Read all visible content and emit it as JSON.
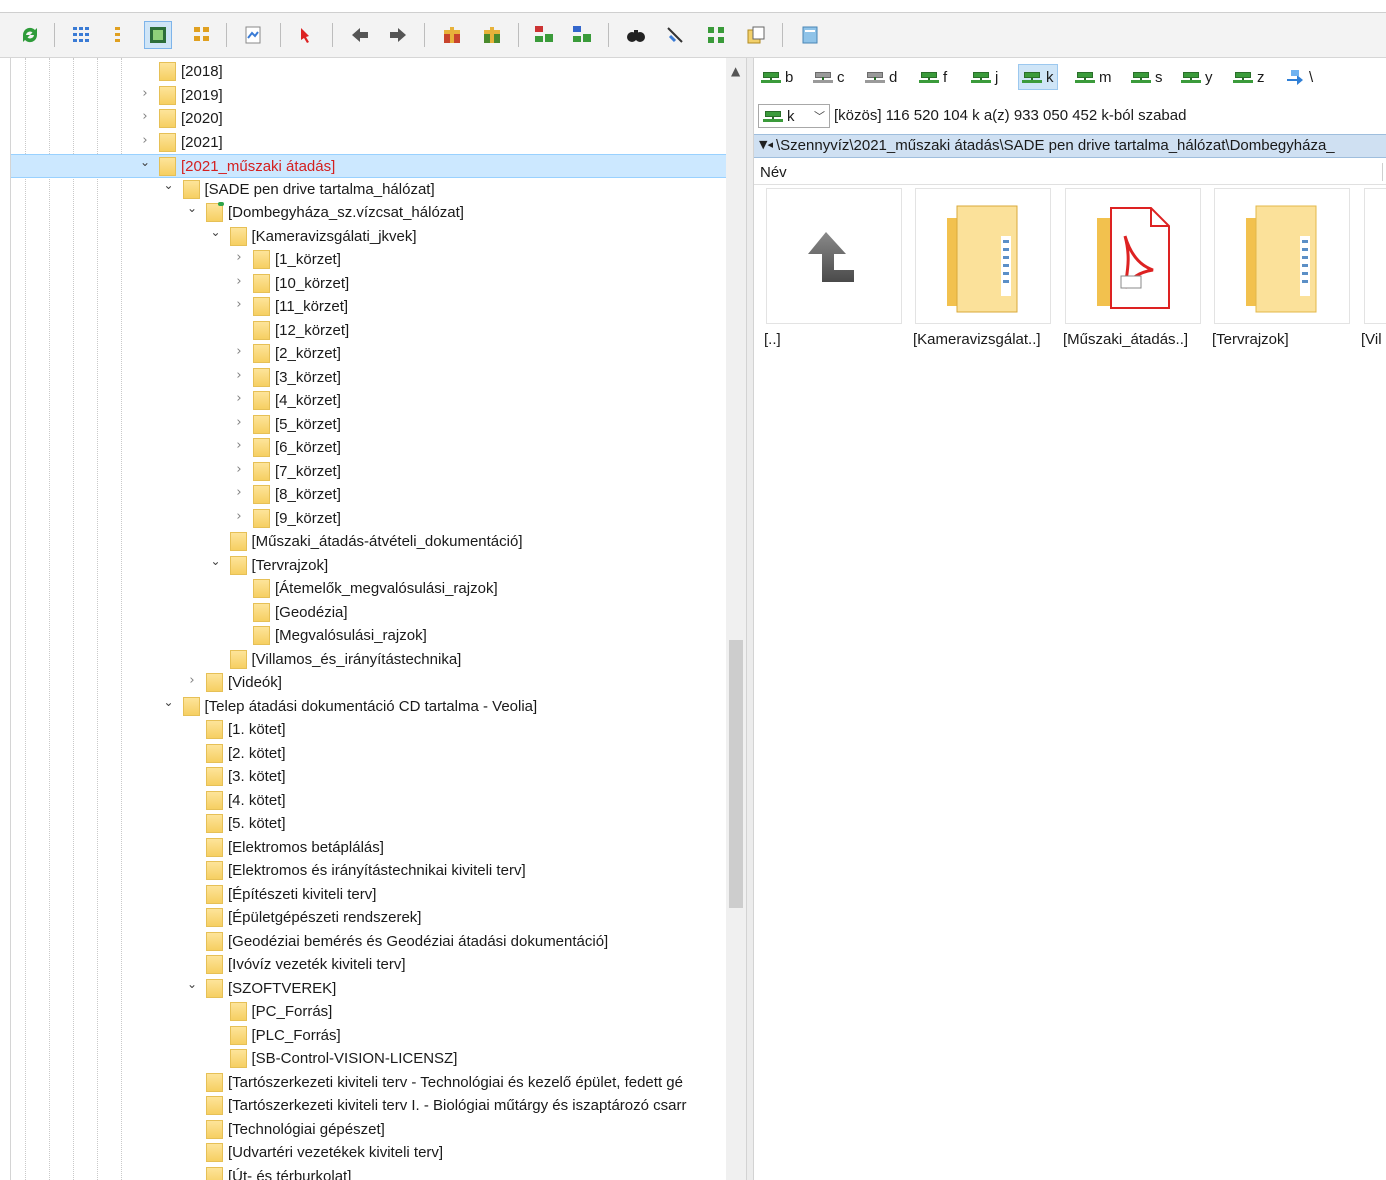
{
  "toolbar": {
    "buttons": [
      {
        "icon": "refresh-icon"
      },
      {
        "icon": "brief-view-icon"
      },
      {
        "icon": "detailed-view-icon"
      },
      {
        "icon": "thumbnail-view-icon"
      },
      {
        "icon": "tree-view-icon"
      },
      {
        "icon": "quick-view-icon"
      },
      {
        "icon": "select-icon"
      },
      {
        "icon": "back-icon"
      },
      {
        "icon": "forward-icon"
      },
      {
        "icon": "pack-icon"
      },
      {
        "icon": "unpack-icon"
      },
      {
        "icon": "ftp-connect-icon"
      },
      {
        "icon": "url-connect-icon"
      },
      {
        "icon": "search-icon"
      },
      {
        "icon": "multi-rename-icon"
      },
      {
        "icon": "sync-dirs-icon"
      },
      {
        "icon": "copy-names-icon"
      },
      {
        "icon": "notepad-icon"
      }
    ]
  },
  "tree": {
    "items": [
      {
        "label": "[2018]",
        "level": 0,
        "state": "none"
      },
      {
        "label": "[2019]",
        "level": 0,
        "state": "closed"
      },
      {
        "label": "[2020]",
        "level": 0,
        "state": "closed"
      },
      {
        "label": "[2021]",
        "level": 0,
        "state": "closed"
      },
      {
        "label": "[2021_műszaki átadás]",
        "level": 0,
        "state": "open",
        "selected": true
      },
      {
        "label": "[SADE pen drive tartalma_hálózat]",
        "level": 1,
        "state": "open"
      },
      {
        "label": "[Dombegyháza_sz.vízcsat_hálózat]",
        "level": 2,
        "state": "open",
        "green": true
      },
      {
        "label": "[Kameravizsgálati_jkvek]",
        "level": 3,
        "state": "open"
      },
      {
        "label": "[1_körzet]",
        "level": 4,
        "state": "closed"
      },
      {
        "label": "[10_körzet]",
        "level": 4,
        "state": "closed"
      },
      {
        "label": "[11_körzet]",
        "level": 4,
        "state": "closed"
      },
      {
        "label": "[12_körzet]",
        "level": 4,
        "state": "none"
      },
      {
        "label": "[2_körzet]",
        "level": 4,
        "state": "closed"
      },
      {
        "label": "[3_körzet]",
        "level": 4,
        "state": "closed"
      },
      {
        "label": "[4_körzet]",
        "level": 4,
        "state": "closed"
      },
      {
        "label": "[5_körzet]",
        "level": 4,
        "state": "closed"
      },
      {
        "label": "[6_körzet]",
        "level": 4,
        "state": "closed"
      },
      {
        "label": "[7_körzet]",
        "level": 4,
        "state": "closed"
      },
      {
        "label": "[8_körzet]",
        "level": 4,
        "state": "closed"
      },
      {
        "label": "[9_körzet]",
        "level": 4,
        "state": "closed"
      },
      {
        "label": "[Műszaki_átadás-átvételi_dokumentáció]",
        "level": 3,
        "state": "none"
      },
      {
        "label": "[Tervrajzok]",
        "level": 3,
        "state": "open"
      },
      {
        "label": "[Átemelők_megvalósulási_rajzok]",
        "level": 4,
        "state": "none"
      },
      {
        "label": "[Geodézia]",
        "level": 4,
        "state": "none"
      },
      {
        "label": "[Megvalósulási_rajzok]",
        "level": 4,
        "state": "none"
      },
      {
        "label": "[Villamos_és_irányítástechnika]",
        "level": 3,
        "state": "none"
      },
      {
        "label": "[Videók]",
        "level": 2,
        "state": "closed"
      },
      {
        "label": "[Telep átadási dokumentáció CD tartalma - Veolia]",
        "level": 1,
        "state": "open"
      },
      {
        "label": "[1. kötet]",
        "level": 2,
        "state": "none"
      },
      {
        "label": "[2. kötet]",
        "level": 2,
        "state": "none"
      },
      {
        "label": "[3. kötet]",
        "level": 2,
        "state": "none"
      },
      {
        "label": "[4. kötet]",
        "level": 2,
        "state": "none"
      },
      {
        "label": "[5. kötet]",
        "level": 2,
        "state": "none"
      },
      {
        "label": "[Elektromos betáplálás]",
        "level": 2,
        "state": "none"
      },
      {
        "label": "[Elektromos és irányítástechnikai kiviteli terv]",
        "level": 2,
        "state": "none"
      },
      {
        "label": "[Építészeti kiviteli terv]",
        "level": 2,
        "state": "none"
      },
      {
        "label": "[Épületgépészeti rendszerek]",
        "level": 2,
        "state": "none"
      },
      {
        "label": "[Geodéziai bemérés és Geodéziai átadási dokumentáció]",
        "level": 2,
        "state": "none"
      },
      {
        "label": "[Ivóvíz vezeték kiviteli terv]",
        "level": 2,
        "state": "none"
      },
      {
        "label": "[SZOFTVEREK]",
        "level": 2,
        "state": "open"
      },
      {
        "label": "[PC_Forrás]",
        "level": 3,
        "state": "none"
      },
      {
        "label": "[PLC_Forrás]",
        "level": 3,
        "state": "none"
      },
      {
        "label": "[SB-Control-VISION-LICENSZ]",
        "level": 3,
        "state": "none"
      },
      {
        "label": "[Tartószerkezeti kiviteli terv - Technológiai és kezelő épület, fedett gé",
        "level": 2,
        "state": "none"
      },
      {
        "label": "[Tartószerkezeti kiviteli terv I. - Biológiai műtárgy és iszaptározó csarr",
        "level": 2,
        "state": "none"
      },
      {
        "label": "[Technológiai gépészet]",
        "level": 2,
        "state": "none"
      },
      {
        "label": "[Udvartéri vezetékek kiviteli terv]",
        "level": 2,
        "state": "none"
      },
      {
        "label": "[Út- és térburkolat]",
        "level": 2,
        "state": "none"
      }
    ]
  },
  "drives": [
    {
      "letter": "b",
      "type": "net"
    },
    {
      "letter": "c",
      "type": "local"
    },
    {
      "letter": "d",
      "type": "cd"
    },
    {
      "letter": "f",
      "type": "net"
    },
    {
      "letter": "j",
      "type": "net"
    },
    {
      "letter": "k",
      "type": "net",
      "active": true
    },
    {
      "letter": "m",
      "type": "net"
    },
    {
      "letter": "s",
      "type": "net"
    },
    {
      "letter": "y",
      "type": "net"
    },
    {
      "letter": "z",
      "type": "net"
    },
    {
      "letter": "\\",
      "type": "root"
    }
  ],
  "info": {
    "drive_selected": "k",
    "text": "[közös]  116 520 104 k a(z) 933 050 452 k-ból szabad"
  },
  "path": "\\Szennyvíz\\2021_műszaki átadás\\SADE pen drive tartalma_hálózat\\Dombegyháza_",
  "column_header": "Név",
  "files": [
    {
      "label": "[..]",
      "kind": "up"
    },
    {
      "label": "[Kameravizsgálat..]",
      "kind": "folder"
    },
    {
      "label": "[Műszaki_átadás..]",
      "kind": "pdf-folder"
    },
    {
      "label": "[Tervrajzok]",
      "kind": "folder"
    },
    {
      "label": "[Vil",
      "kind": "folder"
    }
  ],
  "colors": {
    "selection": "#cce8ff",
    "selected_text": "#d42020",
    "path_bar": "#cfe0f2",
    "folder": "#f6cf62"
  }
}
